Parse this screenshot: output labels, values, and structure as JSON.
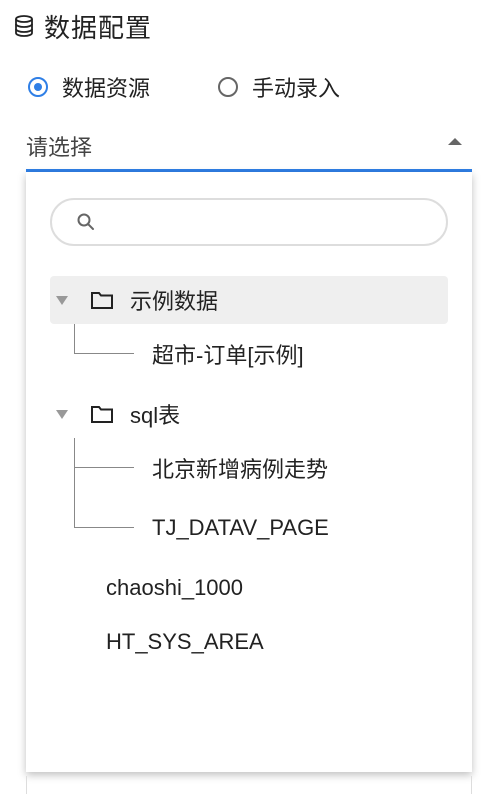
{
  "header": {
    "title": "数据配置",
    "icon": "database-icon"
  },
  "source_mode": {
    "options": [
      {
        "label": "数据资源",
        "checked": true
      },
      {
        "label": "手动录入",
        "checked": false
      }
    ]
  },
  "select": {
    "value": "请选择",
    "expanded": true
  },
  "dropdown": {
    "search": {
      "placeholder": "",
      "value": ""
    },
    "tree": [
      {
        "label": "示例数据",
        "type": "folder",
        "expanded": true,
        "highlighted": true,
        "children": [
          {
            "label": "超市-订单[示例]"
          }
        ]
      },
      {
        "label": "sql表",
        "type": "folder",
        "expanded": true,
        "children": [
          {
            "label": "北京新增病例走势"
          },
          {
            "label": "TJ_DATAV_PAGE"
          }
        ]
      },
      {
        "label": "chaoshi_1000",
        "type": "leaf"
      },
      {
        "label": "HT_SYS_AREA",
        "type": "leaf"
      }
    ]
  },
  "colors": {
    "accent": "#2f7fe6",
    "highlight": "#efefef"
  }
}
